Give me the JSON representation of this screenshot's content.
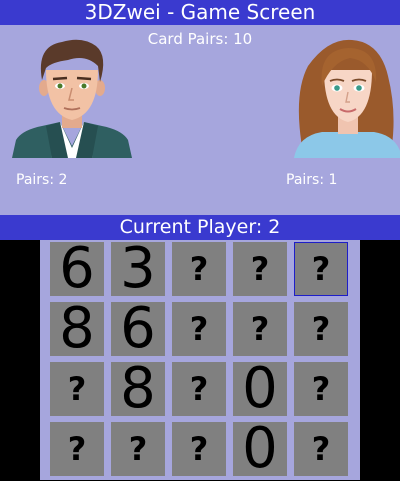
{
  "header": {
    "title": "3DZwei - Game Screen"
  },
  "game": {
    "card_pairs": "Card Pairs: 10"
  },
  "players": [
    {
      "pairs_text": "Pairs: 2"
    },
    {
      "pairs_text": "Pairs: 1"
    }
  ],
  "status": {
    "current_player": "Current Player: 2"
  },
  "board": {
    "rows": [
      [
        "6",
        "3",
        "?",
        "?",
        "?"
      ],
      [
        "8",
        "6",
        "?",
        "?",
        "?"
      ],
      [
        "?",
        "8",
        "?",
        "0",
        "?"
      ],
      [
        "?",
        "?",
        "?",
        "0",
        "?"
      ]
    ],
    "selected": {
      "row": 0,
      "col": 4
    }
  },
  "colors": {
    "background": "#a6a6dd",
    "bar": "#3a3acf",
    "card": "#808080",
    "selection": "#1e1ec8"
  }
}
